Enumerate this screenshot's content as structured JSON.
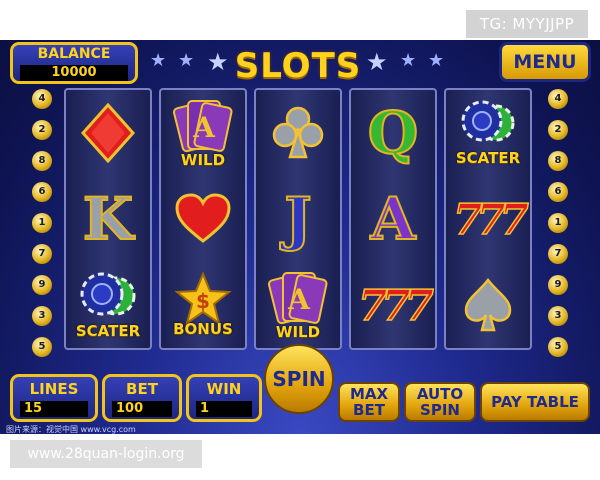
{
  "watermarks": {
    "tg": "TG: MYYJJPP",
    "site": "www.28quan-login.org",
    "credit": "图片来源：视觉中国 www.vcg.com"
  },
  "header": {
    "balance_label": "BALANCE",
    "balance_value": "10000",
    "title": "SLOTS",
    "menu_label": "MENU"
  },
  "side_numbers": {
    "left": [
      "4",
      "2",
      "8",
      "6",
      "1",
      "7",
      "9",
      "3",
      "5"
    ],
    "right": [
      "4",
      "2",
      "8",
      "6",
      "1",
      "7",
      "9",
      "3",
      "5"
    ]
  },
  "reels": [
    [
      {
        "kind": "diamond-icon",
        "caption": ""
      },
      {
        "kind": "letter-k",
        "text": "K"
      },
      {
        "kind": "chips-icon",
        "caption": "SCATER"
      }
    ],
    [
      {
        "kind": "wild-cards",
        "caption": "WILD",
        "text": "A"
      },
      {
        "kind": "heart-icon",
        "caption": ""
      },
      {
        "kind": "bonus-star",
        "caption": "BONUS",
        "text": "$"
      }
    ],
    [
      {
        "kind": "club-icon",
        "caption": ""
      },
      {
        "kind": "letter-j",
        "text": "J"
      },
      {
        "kind": "wild-cards",
        "caption": "WILD",
        "text": "A"
      }
    ],
    [
      {
        "kind": "letter-q",
        "text": "Q"
      },
      {
        "kind": "letter-a",
        "text": "A"
      },
      {
        "kind": "seven",
        "text": "777"
      }
    ],
    [
      {
        "kind": "chips-icon",
        "caption": "SCATER"
      },
      {
        "kind": "seven",
        "text": "777"
      },
      {
        "kind": "spade-icon",
        "caption": ""
      }
    ]
  ],
  "controls": {
    "lines": {
      "label": "LINES",
      "value": "15"
    },
    "bet": {
      "label": "BET",
      "value": "100"
    },
    "win": {
      "label": "WIN",
      "value": "1"
    },
    "spin_label": "SPIN",
    "max_bet_line1": "MAX",
    "max_bet_line2": "BET",
    "auto_spin_line1": "AUTO",
    "auto_spin_line2": "SPIN",
    "pay_table_label": "PAY TABLE"
  },
  "colors": {
    "gold": "#ffd21e",
    "panel_blue": "#1d2680",
    "wild_purple": "#7a2fb0",
    "red": "#e11d1d"
  }
}
